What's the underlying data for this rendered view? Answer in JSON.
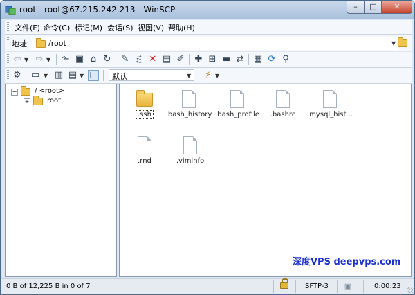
{
  "window": {
    "title": "root - root@67.215.242.213 - WinSCP",
    "minimize": "–",
    "maximize": "□",
    "close": "✕"
  },
  "menu": [
    {
      "label": "文件(F)"
    },
    {
      "label": "命令(C)"
    },
    {
      "label": "标记(M)"
    },
    {
      "label": "会话(S)"
    },
    {
      "label": "视图(V)"
    },
    {
      "label": "帮助(H)"
    }
  ],
  "address": {
    "label": "地址",
    "value": "/root"
  },
  "toolbar2": {
    "transfer_setting": "默认"
  },
  "tree": [
    {
      "label": "/ <root>",
      "expander": "−"
    },
    {
      "label": "root",
      "expander": "+"
    }
  ],
  "files": [
    {
      "name": ".ssh",
      "type": "folder"
    },
    {
      "name": ".bash_history",
      "type": "file"
    },
    {
      "name": ".bash_profile",
      "type": "file"
    },
    {
      "name": ".bashrc",
      "type": "file"
    },
    {
      "name": ".mysql_hist...",
      "type": "file"
    },
    {
      "name": ".rnd",
      "type": "file"
    },
    {
      "name": ".viminfo",
      "type": "file"
    }
  ],
  "watermark": "深度VPS deepvps.com",
  "status": {
    "selection": "0 B of 12,225 B in 0 of 7",
    "protocol": "SFTP-3",
    "elapsed": "0:00:23"
  },
  "colors": {
    "accent": "#1a2fd0",
    "folder": "#f0c44c",
    "close_button": "#c7432d"
  }
}
